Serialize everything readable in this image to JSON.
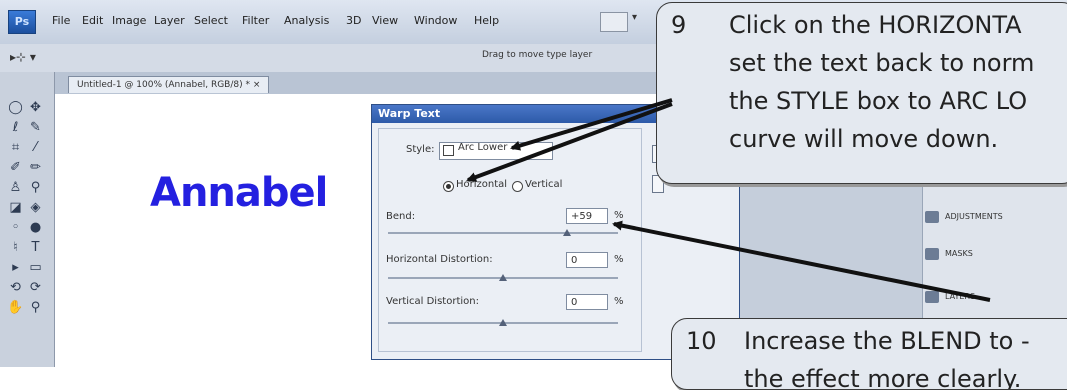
{
  "app": {
    "logo": "Ps",
    "menu": [
      "File",
      "Edit",
      "Image",
      "Layer",
      "Select",
      "Filter",
      "Analysis",
      "3D",
      "View",
      "Window",
      "Help"
    ],
    "options_hint": "Drag to move type layer",
    "doc_tab": "Untitled-1 @ 100% (Annabel, RGB/8) *  ×"
  },
  "canvas": {
    "text": "Annabel",
    "text_color": "#2420e0"
  },
  "warp_dialog": {
    "title": "Warp Text",
    "style_label": "Style:",
    "style_value": "Arc Lower",
    "radio_horizontal": "Horizontal",
    "radio_vertical": "Vertical",
    "bend_label": "Bend:",
    "bend_value": "+59",
    "h_distortion_label": "Horizontal Distortion:",
    "h_distortion_value": "0",
    "v_distortion_label": "Vertical Distortion:",
    "v_distortion_value": "0",
    "percent": "%"
  },
  "panels": {
    "adjustments": "ADJUSTMENTS",
    "masks": "MASKS",
    "layers": "LAYERS"
  },
  "callouts": {
    "step9": {
      "number": "9",
      "lines": [
        "Click on the HORIZONTA",
        "set the text back to norm",
        "the STYLE box to ARC LO",
        "curve will move down."
      ]
    },
    "step10": {
      "number": "10",
      "lines": [
        "Increase the BLEND to -",
        "the effect more clearly."
      ]
    }
  },
  "colors": {
    "callout_bg": "#e4e9f0",
    "arrow": "#111111",
    "dialog_title": "#2d5aa8"
  }
}
